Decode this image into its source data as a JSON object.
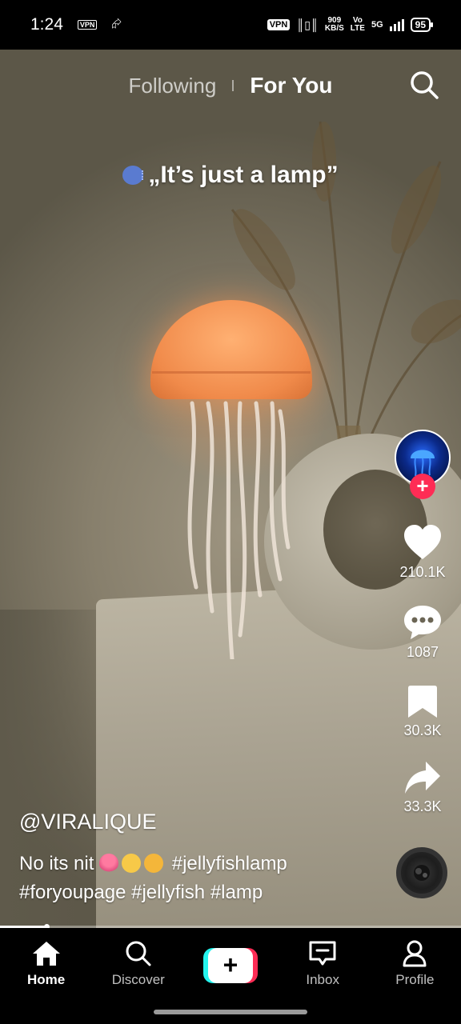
{
  "status_bar": {
    "time": "1:24",
    "vpn_small": "VPN",
    "vpn_badge": "VPN",
    "speed_value": "909",
    "speed_unit": "KB/S",
    "volte": "Vo",
    "lte": "LTE",
    "network": "5G",
    "battery": "95"
  },
  "top_tabs": {
    "following": "Following",
    "for_you": "For You"
  },
  "video": {
    "overlay_caption": "„It’s just a lamp”"
  },
  "actions": {
    "likes": "210.1K",
    "comments": "1087",
    "saves": "30.3K",
    "shares": "33.3K",
    "follow_plus": "+"
  },
  "post": {
    "username": "@VIRALIQUE",
    "text": "No its nit",
    "hashtag_1": "#jellyfishlamp",
    "hashtags_line2": "#foryoupage #jellyfish #lamp"
  },
  "progress": {
    "fraction": 0.1
  },
  "nav": {
    "home": "Home",
    "discover": "Discover",
    "create": "+",
    "inbox": "Inbox",
    "profile": "Profile"
  },
  "colors": {
    "accent_red": "#fe2c55",
    "accent_cyan": "#25f4ee"
  }
}
